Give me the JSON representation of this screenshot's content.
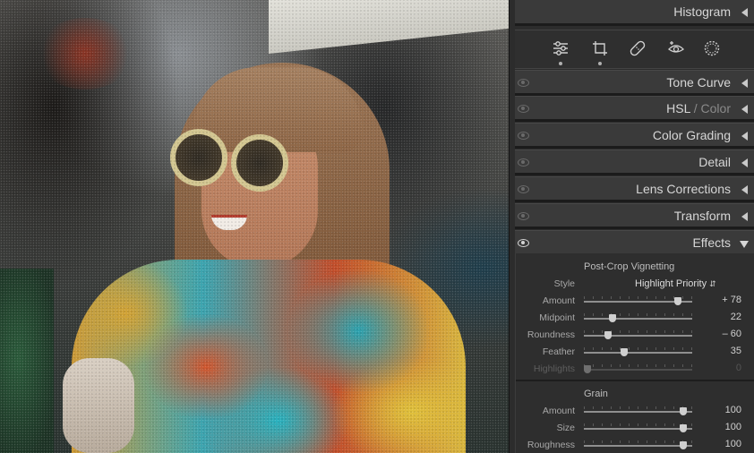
{
  "panels": {
    "histogram": "Histogram",
    "tone_curve": "Tone Curve",
    "hsl": "HSL",
    "hsl_sep": " / ",
    "color": "Color",
    "color_grading": "Color Grading",
    "detail": "Detail",
    "lens_corrections": "Lens Corrections",
    "transform": "Transform",
    "effects": "Effects"
  },
  "toolbar": {
    "icons": [
      "sliders-icon",
      "crop-icon",
      "healing-icon",
      "red-eye-icon",
      "masking-icon"
    ]
  },
  "vignetting": {
    "title": "Post-Crop Vignetting",
    "style_label": "Style",
    "style_value": "Highlight Priority",
    "rows": [
      {
        "label": "Amount",
        "value": "+ 78",
        "level": 0.89
      },
      {
        "label": "Midpoint",
        "value": "22",
        "level": 0.25
      },
      {
        "label": "Roundness",
        "value": "– 60",
        "level": 0.2
      },
      {
        "label": "Feather",
        "value": "35",
        "level": 0.36
      },
      {
        "label": "Highlights",
        "value": "0",
        "level": 0.0
      }
    ]
  },
  "grain": {
    "title": "Grain",
    "rows": [
      {
        "label": "Amount",
        "value": "100",
        "level": 0.95
      },
      {
        "label": "Size",
        "value": "100",
        "level": 0.95
      },
      {
        "label": "Roughness",
        "value": "100",
        "level": 0.95
      }
    ]
  }
}
